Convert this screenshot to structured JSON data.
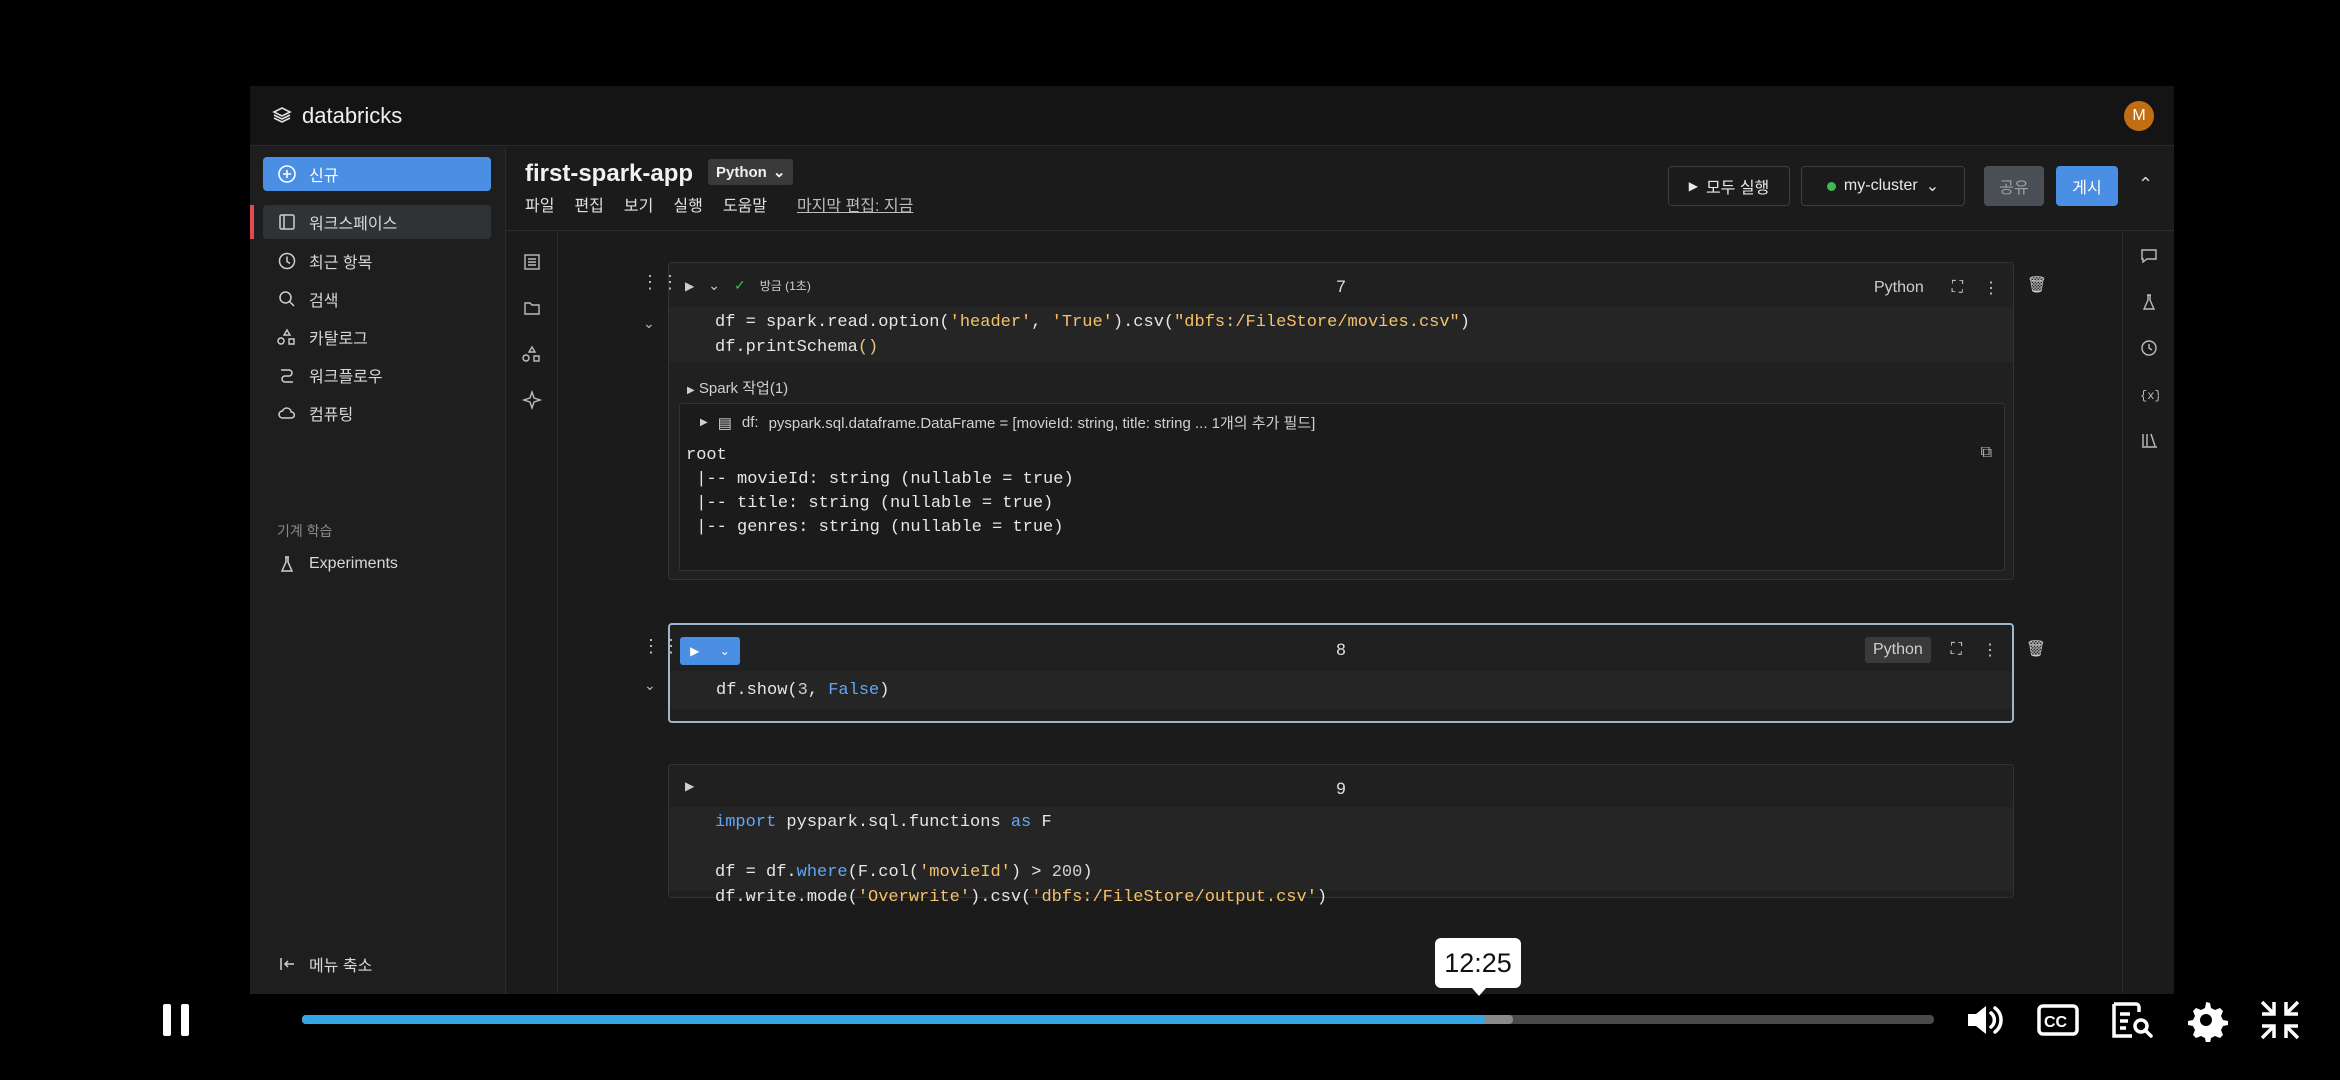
{
  "app": {
    "brand": "databricks",
    "avatar_initial": "M",
    "accent": "#4a8fe4"
  },
  "sidebar": {
    "new_label": "신규",
    "items": [
      {
        "label": "워크스페이스",
        "icon": "workspace-icon"
      },
      {
        "label": "최근 항목",
        "icon": "clock-icon"
      },
      {
        "label": "검색",
        "icon": "search-icon"
      },
      {
        "label": "카탈로그",
        "icon": "catalog-icon"
      },
      {
        "label": "워크플로우",
        "icon": "workflow-icon"
      },
      {
        "label": "컴퓨팅",
        "icon": "cloud-icon"
      }
    ],
    "section_ml": "기계 학습",
    "experiments_label": "Experiments",
    "collapse_label": "메뉴 축소"
  },
  "notebook": {
    "title": "first-spark-app",
    "language": "Python",
    "menu": [
      "파일",
      "편집",
      "보기",
      "실행",
      "도움말"
    ],
    "last_edit": "마지막 편집: 지금",
    "run_all": "모두 실행",
    "cluster": "my-cluster",
    "cluster_status_color": "#3fb950",
    "share": "공유",
    "publish": "게시"
  },
  "cells": [
    {
      "number": "7",
      "status": "방금 (1초)",
      "language": "Python",
      "spark_jobs": "Spark 작업(1)",
      "df_label": "df:",
      "df_schema": "pyspark.sql.dataframe.DataFrame = [movieId: string, title: string ... 1개의 추가 필드]",
      "output_lines": [
        "root",
        " |-- movieId: string (nullable = true)",
        " |-- title: string (nullable = true)",
        " |-- genres: string (nullable = true)"
      ]
    },
    {
      "number": "8",
      "language": "Python"
    },
    {
      "number": "9"
    }
  ],
  "player": {
    "time": "12:25",
    "progress": 0.725,
    "buffered": 0.742
  }
}
